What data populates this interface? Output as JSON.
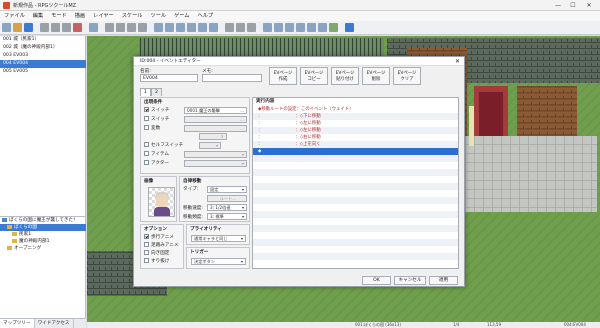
{
  "window": {
    "title": "新規作品 - RPGツクールMZ",
    "minimize": "—",
    "maximize": "☐",
    "close": "✕"
  },
  "menu": [
    "ファイル",
    "編集",
    "モード",
    "描画",
    "レイヤー",
    "スケール",
    "ツール",
    "ゲーム",
    "ヘルプ"
  ],
  "map_list": [
    {
      "label": "001 城（民家1）",
      "selected": false
    },
    {
      "label": "002 城（魔の神殿内部1）",
      "selected": false
    },
    {
      "label": "003 EV003",
      "selected": false
    },
    {
      "label": "004 EV004",
      "selected": true
    },
    {
      "label": "005 EV005",
      "selected": false
    }
  ],
  "map_tree": [
    {
      "label": "ぼくらの国に魔王が襲してきた！",
      "level": 0,
      "selected": false,
      "folder": "blue"
    },
    {
      "label": "ぼくらの国",
      "level": 1,
      "selected": true,
      "folder": "yellow"
    },
    {
      "label": "民家1",
      "level": 2,
      "selected": false,
      "folder": "yellow"
    },
    {
      "label": "魔の神殿内部1",
      "level": 2,
      "selected": false,
      "folder": "yellow"
    },
    {
      "label": "オープニング",
      "level": 1,
      "selected": false,
      "folder": "yellow"
    }
  ],
  "bottom_tabs": [
    "マップツリー",
    "ワイドアクセス"
  ],
  "status": {
    "map": "001:ぼくらの国 (36x13)",
    "zoom": "1/4",
    "coord": "113,59",
    "event": "004:EV004"
  },
  "dialog": {
    "title": "ID:004 - イベントエディター",
    "name_label": "名前:",
    "name_value": "EV004",
    "memo_label": "メモ:",
    "memo_value": "",
    "buttons": [
      {
        "line1": "EVページ",
        "line2": "作成"
      },
      {
        "line1": "EVページ",
        "line2": "コピー"
      },
      {
        "line1": "EVページ",
        "line2": "貼り付け"
      },
      {
        "line1": "EVページ",
        "line2": "削除"
      },
      {
        "line1": "EVページ",
        "line2": "クリア"
      }
    ],
    "page_tabs": [
      "1",
      "2"
    ],
    "conditions": {
      "title": "出現条件",
      "switch1_label": "スイッチ",
      "switch1_value": "0001 魔王の襲撃",
      "switch2_label": "スイッチ",
      "variable_label": "変数",
      "self_switch_label": "セルフスイッチ",
      "item_label": "アイテム",
      "actor_label": "アクター"
    },
    "image_title": "画像",
    "autonomous": {
      "title": "自律移動",
      "type_label": "タイプ:",
      "type_value": "固定",
      "route_button": "ルート...",
      "speed_label": "移動速度:",
      "speed_value": "3: 1/2倍速",
      "freq_label": "移動頻度:",
      "freq_value": "3: 標準"
    },
    "options": {
      "title": "オプション",
      "items": [
        {
          "label": "歩行アニメ",
          "checked": true
        },
        {
          "label": "足踏みアニメ",
          "checked": false
        },
        {
          "label": "向き固定",
          "checked": false
        },
        {
          "label": "すり抜け",
          "checked": false
        }
      ]
    },
    "priority": {
      "title": "プライオリティ",
      "value": "通常キャラと同じ"
    },
    "trigger": {
      "title": "トリガー",
      "value": "決定ボタン"
    },
    "contents_title": "実行内容",
    "contents": [
      {
        "text": "◆移動ルートの設定：このイベント（ウェイト）",
        "red": true,
        "hl": false
      },
      {
        "text": "：　　　　　　　　：◇下に移動",
        "red": true,
        "hl": false
      },
      {
        "text": "：　　　　　　　　：◇左に移動",
        "red": true,
        "hl": false
      },
      {
        "text": "：　　　　　　　　：◇左に移動",
        "red": true,
        "hl": false
      },
      {
        "text": "：　　　　　　　　：◇右に移動",
        "red": true,
        "hl": false
      },
      {
        "text": "：　　　　　　　　：◇上を向く",
        "red": true,
        "hl": false
      },
      {
        "text": "◆",
        "red": false,
        "hl": true
      }
    ],
    "ok": "OK",
    "cancel": "キャンセル",
    "apply": "適用"
  }
}
